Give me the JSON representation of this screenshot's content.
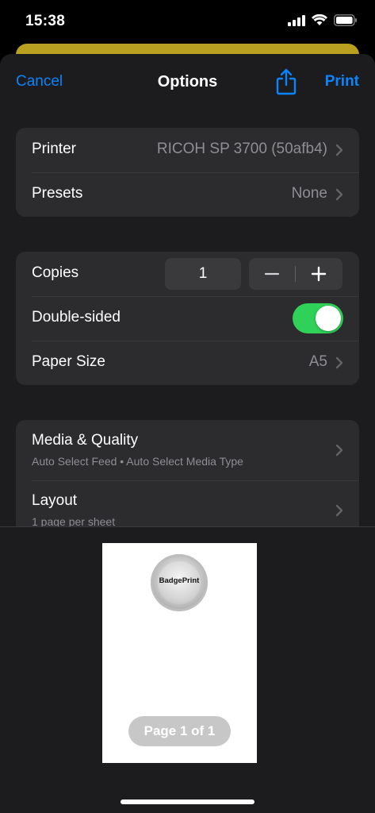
{
  "status_bar": {
    "time": "15:38",
    "icons": [
      "cellular-signal-icon",
      "wifi-icon",
      "battery-icon"
    ]
  },
  "nav": {
    "cancel_label": "Cancel",
    "title": "Options",
    "share_icon": "share-icon",
    "print_label": "Print"
  },
  "printer_group": {
    "printer": {
      "label": "Printer",
      "value": "RICOH SP 3700 (50afb4)"
    },
    "presets": {
      "label": "Presets",
      "value": "None"
    }
  },
  "settings_group": {
    "copies": {
      "label": "Copies",
      "value": "1",
      "decrement_icon": "minus-icon",
      "increment_icon": "plus-icon"
    },
    "double_sided": {
      "label": "Double-sided",
      "enabled": true
    },
    "paper_size": {
      "label": "Paper Size",
      "value": "A5"
    }
  },
  "more_group": {
    "media_quality": {
      "label": "Media & Quality",
      "subtitle": "Auto Select Feed • Auto Select Media Type"
    },
    "layout": {
      "label": "Layout",
      "subtitle": "1 page per sheet"
    }
  },
  "preview": {
    "badge_text": "BadgePrint",
    "page_indicator": "Page 1 of 1"
  },
  "colors": {
    "accent": "#0a84ff",
    "toggle_on": "#30d158",
    "sheet_bg": "#1c1c1e",
    "cell_bg": "#2c2c2e",
    "secondary_text": "#8e8e93"
  }
}
